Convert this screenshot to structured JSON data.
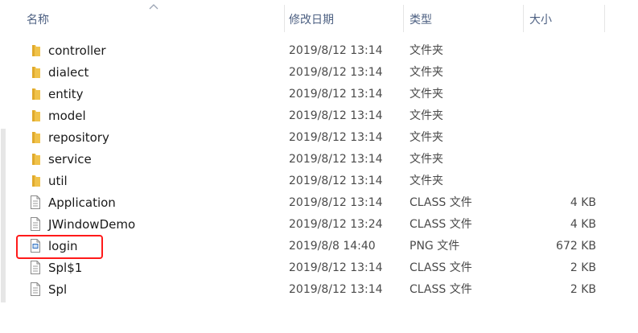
{
  "columns": {
    "name": "名称",
    "date": "修改日期",
    "type": "类型",
    "size": "大小"
  },
  "files": [
    {
      "name": "controller",
      "date": "2019/8/12 13:14",
      "type": "文件夹",
      "size": "",
      "icon": "folder-icon"
    },
    {
      "name": "dialect",
      "date": "2019/8/12 13:14",
      "type": "文件夹",
      "size": "",
      "icon": "folder-icon"
    },
    {
      "name": "entity",
      "date": "2019/8/12 13:14",
      "type": "文件夹",
      "size": "",
      "icon": "folder-icon"
    },
    {
      "name": "model",
      "date": "2019/8/12 13:14",
      "type": "文件夹",
      "size": "",
      "icon": "folder-icon"
    },
    {
      "name": "repository",
      "date": "2019/8/12 13:14",
      "type": "文件夹",
      "size": "",
      "icon": "folder-icon"
    },
    {
      "name": "service",
      "date": "2019/8/12 13:14",
      "type": "文件夹",
      "size": "",
      "icon": "folder-icon"
    },
    {
      "name": "util",
      "date": "2019/8/12 13:14",
      "type": "文件夹",
      "size": "",
      "icon": "folder-icon"
    },
    {
      "name": "Application",
      "date": "2019/8/12 13:14",
      "type": "CLASS 文件",
      "size": "4 KB",
      "icon": "file-icon"
    },
    {
      "name": "JWindowDemo",
      "date": "2019/8/12 13:24",
      "type": "CLASS 文件",
      "size": "4 KB",
      "icon": "file-icon"
    },
    {
      "name": "login",
      "date": "2019/8/8 14:40",
      "type": "PNG 文件",
      "size": "672 KB",
      "icon": "image-file-icon"
    },
    {
      "name": "Spl$1",
      "date": "2019/8/12 13:14",
      "type": "CLASS 文件",
      "size": "2 KB",
      "icon": "file-icon"
    },
    {
      "name": "Spl",
      "date": "2019/8/12 13:14",
      "type": "CLASS 文件",
      "size": "2 KB",
      "icon": "file-icon"
    }
  ],
  "colors": {
    "folder": "#f0c24a",
    "header_text": "#4d6082",
    "highlight": "#ff1a1a"
  }
}
